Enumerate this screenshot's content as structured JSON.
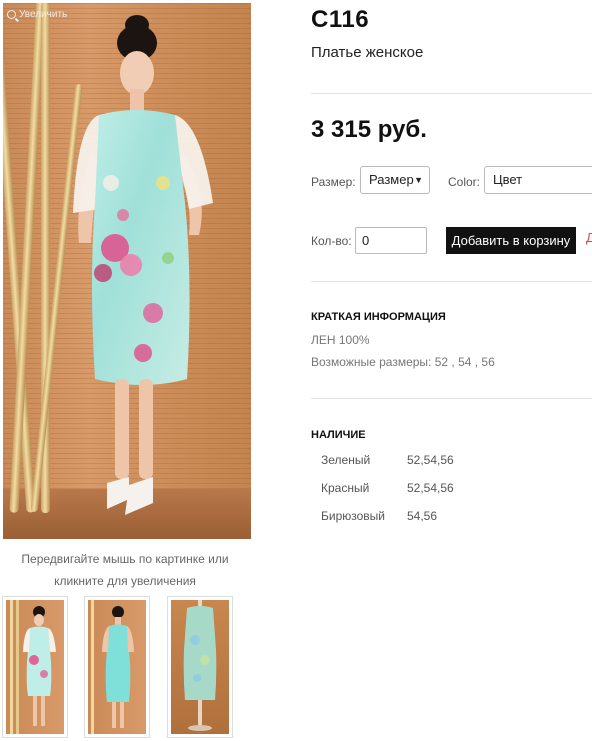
{
  "gallery": {
    "zoom_label": "Увеличить",
    "hint": "Передвигайте мышь по картинке или кликните для увеличения",
    "thumbnails": [
      "thumb-front",
      "thumb-back",
      "thumb-mannequin"
    ]
  },
  "product": {
    "sku": "С116",
    "subtitle": "Платье женское",
    "price": "3 315 руб."
  },
  "options": {
    "size_label": "Размер:",
    "size_value": "Размер",
    "color_label": "Color:",
    "color_value": "Цвет",
    "qty_label": "Кол-во:",
    "qty_value": "0",
    "add_to_cart": "Добавить в корзину",
    "cut_link": "Д"
  },
  "summary": {
    "title": "КРАТКАЯ ИНФОРМАЦИЯ",
    "material": "ЛЕН 100%",
    "sizes": "Возможные размеры: 52 , 54 , 56"
  },
  "availability": {
    "title": "НАЛИЧИЕ",
    "rows": [
      {
        "color": "Зеленый",
        "sizes": "52,54,56"
      },
      {
        "color": "Красный",
        "sizes": "52,54,56"
      },
      {
        "color": "Бирюзовый",
        "sizes": "54,56"
      }
    ]
  },
  "icons": {
    "zoom": "magnifier-icon",
    "dropdown": "chevron-down-icon"
  }
}
